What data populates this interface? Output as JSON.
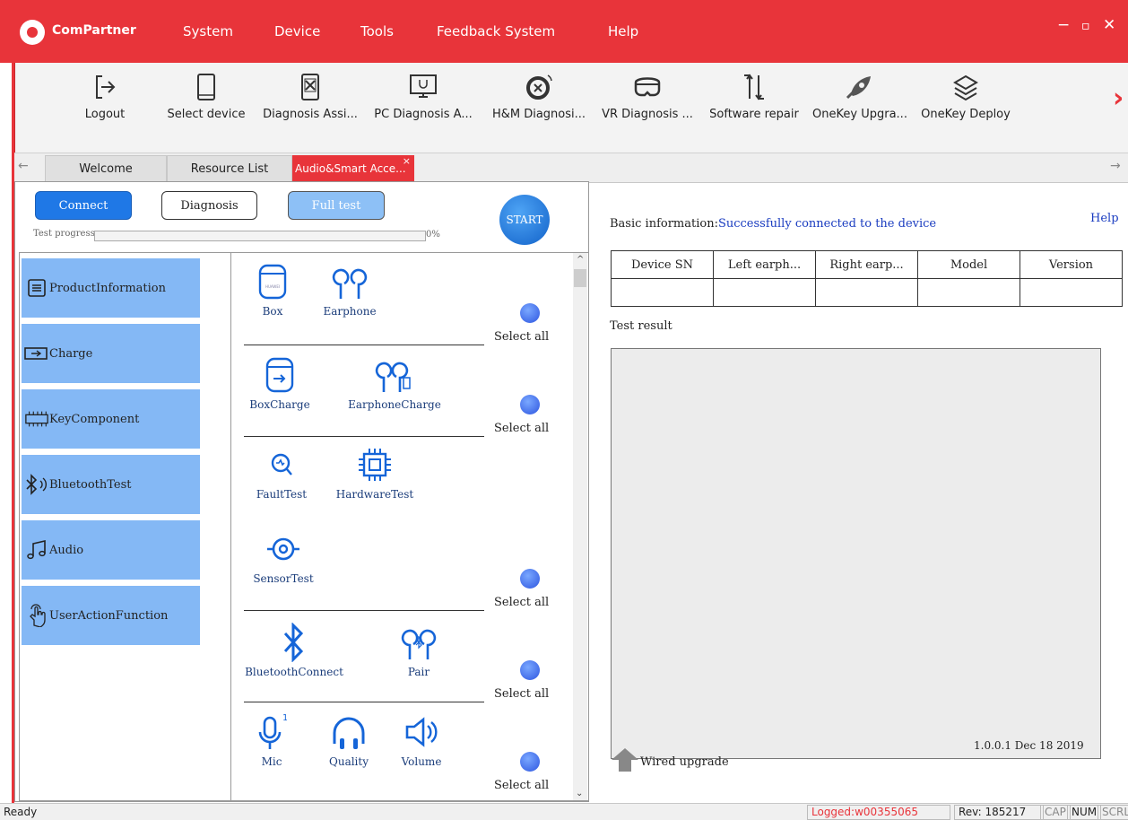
{
  "titlebar": {
    "app_name": "ComPartner",
    "menu": [
      "System",
      "Device",
      "Tools",
      "Feedback System",
      "Help"
    ],
    "window_controls": {
      "minimize": "−",
      "maximize": "▫",
      "close": "✕"
    }
  },
  "toolbar": {
    "items": [
      {
        "label": "Logout",
        "icon": "logout-icon"
      },
      {
        "label": "Select device",
        "icon": "phone-icon"
      },
      {
        "label": "Diagnosis Assi...",
        "icon": "phone-diagnosis-icon"
      },
      {
        "label": "PC Diagnosis A...",
        "icon": "pc-stethoscope-icon"
      },
      {
        "label": "H&M Diagnosi...",
        "icon": "watch-diagnosis-icon"
      },
      {
        "label": "VR Diagnosis ...",
        "icon": "vr-headset-icon"
      },
      {
        "label": "Software repair",
        "icon": "software-repair-icon"
      },
      {
        "label": "OneKey Upgra...",
        "icon": "rocket-icon"
      },
      {
        "label": "OneKey Deploy",
        "icon": "layers-icon"
      }
    ],
    "next_arrow": "›"
  },
  "tabs": [
    {
      "label": "Welcome",
      "active": false
    },
    {
      "label": "Resource List",
      "active": false
    },
    {
      "label": "Audio&Smart Acce...",
      "active": true
    }
  ],
  "tab_close": "×",
  "controls": {
    "connect": "Connect",
    "diagnosis": "Diagnosis",
    "full_test": "Full test",
    "start": "START",
    "progress_label": "Test progress:",
    "progress_value": "0%",
    "progress_fraction": 0
  },
  "categories": [
    {
      "label": "ProductInformation",
      "icon": "document-icon"
    },
    {
      "label": "Charge",
      "icon": "battery-charge-icon"
    },
    {
      "label": "KeyComponent",
      "icon": "chip-icon"
    },
    {
      "label": "BluetoothTest",
      "icon": "bluetooth-icon"
    },
    {
      "label": "Audio",
      "icon": "music-note-icon"
    },
    {
      "label": "UserActionFunction",
      "icon": "hand-tap-icon"
    }
  ],
  "test_items": {
    "box": "Box",
    "earphone": "Earphone",
    "box_charge": "BoxCharge",
    "earphone_charge": "EarphoneCharge",
    "fault_test": "FaultTest",
    "hardware_test": "HardwareTest",
    "sensor_test": "SensorTest",
    "bluetooth_connect": "BluetoothConnect",
    "pair": "Pair",
    "mic": "Mic",
    "quality": "Quality",
    "volume": "Volume",
    "select_all": "Select all",
    "box_brand": "HUAWEI",
    "mic_channel": "1"
  },
  "right": {
    "help": "Help",
    "basic_info_label": "Basic information:",
    "basic_info_status": "Successfully connected to the device",
    "table_headers": [
      "Device SN",
      "Left earph...",
      "Right earp...",
      "Model",
      "Version"
    ],
    "test_result_label": "Test result",
    "version_text": "1.0.0.1 Dec 18 2019",
    "wired_upgrade": "Wired upgrade"
  },
  "statusbar": {
    "ready": "Ready",
    "logged": "Logged:w00355065",
    "rev": "Rev: 185217",
    "cap": "CAP",
    "num": "NUM",
    "scrl": "SCRL"
  },
  "colors": {
    "brand_red": "#e8343a",
    "category_blue": "#84b8f5",
    "connect_blue": "#1f78e6",
    "fulltest_blue": "#8dc0f6",
    "icon_blue": "#1565d8",
    "status_link": "#1a3cc0"
  }
}
